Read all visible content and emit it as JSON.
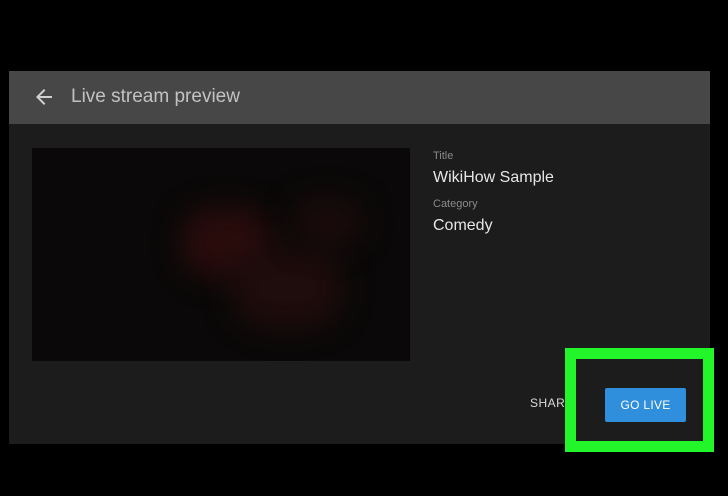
{
  "dialog": {
    "title": "Live stream preview",
    "back_icon": "arrow-left-icon"
  },
  "details": {
    "title_label": "Title",
    "title_value": "WikiHow Sample",
    "category_label": "Category",
    "category_value": "Comedy"
  },
  "actions": {
    "share_label": "SHAR",
    "go_live_label": "GO LIVE"
  },
  "colors": {
    "page_background": "#000000",
    "dialog_background": "#1c1c1c",
    "header_background": "#474747",
    "primary_button": "#2f8fdd",
    "highlight_frame": "#22f52a"
  }
}
